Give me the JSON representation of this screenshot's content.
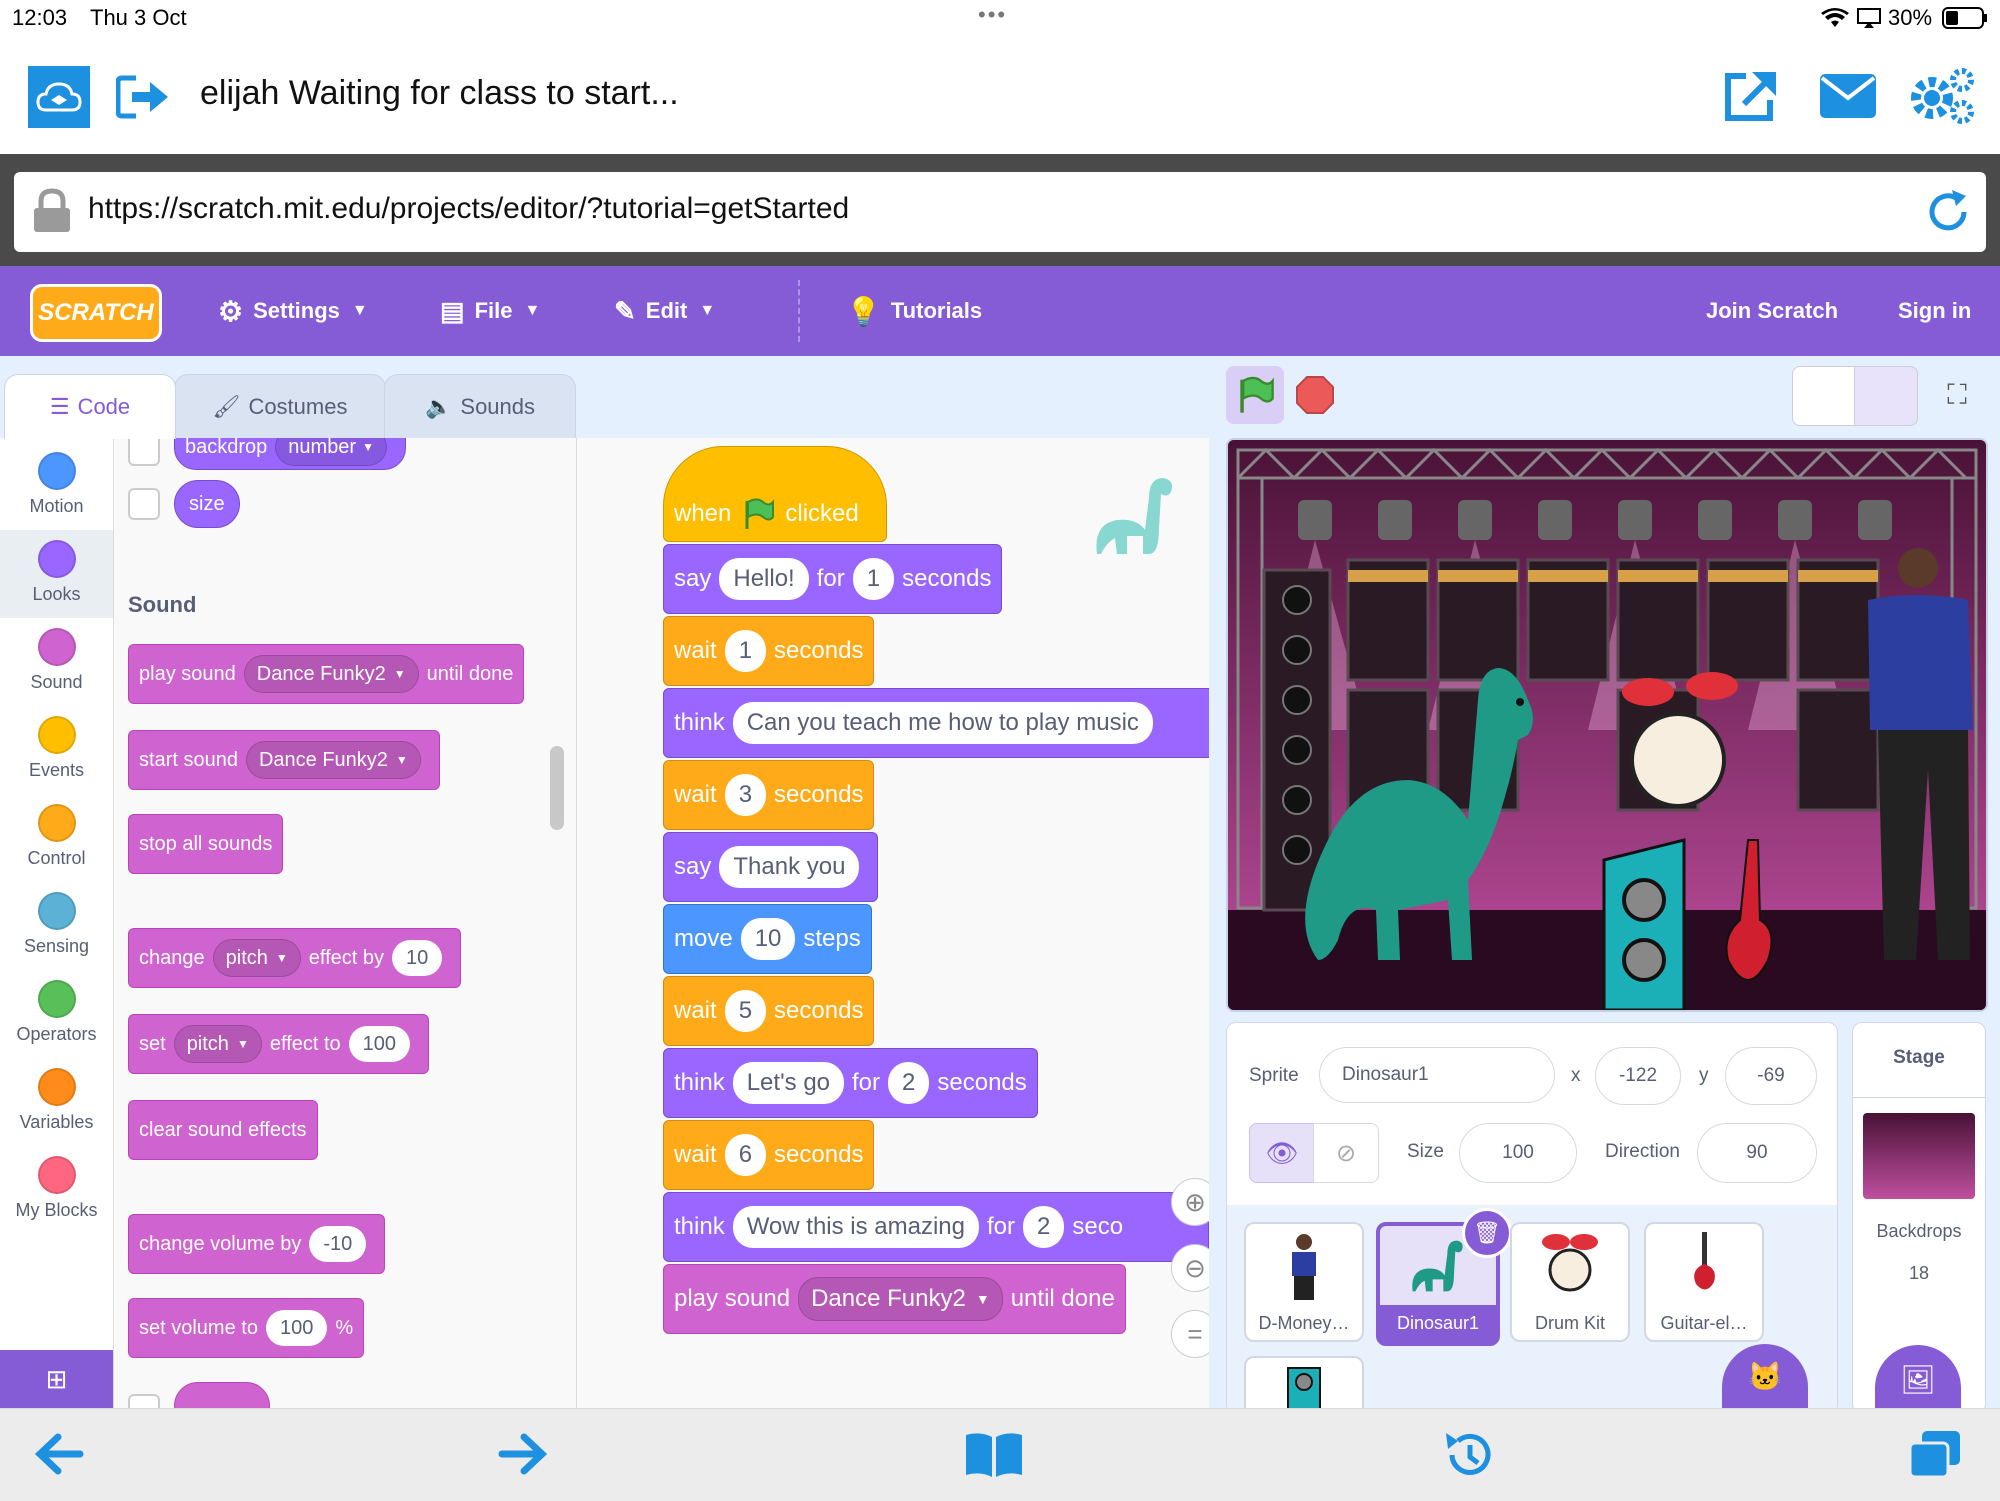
{
  "status": {
    "time": "12:03",
    "date": "Thu 3 Oct",
    "battery": "30%"
  },
  "header": {
    "title": "elijah Waiting for class to start..."
  },
  "url": "https://scratch.mit.edu/projects/editor/?tutorial=getStarted",
  "menu": {
    "settings": "Settings",
    "file": "File",
    "edit": "Edit",
    "tutorials": "Tutorials",
    "join": "Join Scratch",
    "signin": "Sign in"
  },
  "logo_text": "SCRATCH",
  "tabs": {
    "code": "Code",
    "costumes": "Costumes",
    "sounds": "Sounds"
  },
  "categories": [
    {
      "label": "Motion",
      "color": "#4c97ff"
    },
    {
      "label": "Looks",
      "color": "#9966ff"
    },
    {
      "label": "Sound",
      "color": "#cf63cf"
    },
    {
      "label": "Events",
      "color": "#ffbf00"
    },
    {
      "label": "Control",
      "color": "#ffab19"
    },
    {
      "label": "Sensing",
      "color": "#5cb1d6"
    },
    {
      "label": "Operators",
      "color": "#59c059"
    },
    {
      "label": "Variables",
      "color": "#ff8c1a"
    },
    {
      "label": "My Blocks",
      "color": "#ff6680"
    }
  ],
  "palette": {
    "backdrop": "backdrop",
    "number": "number",
    "size": "size",
    "sound_heading": "Sound",
    "play_sound": "play sound",
    "until_done": "until done",
    "sound_name": "Dance Funky2",
    "start_sound": "start sound",
    "stop_all": "stop all sounds",
    "change": "change",
    "pitch": "pitch",
    "effect_by": "effect by",
    "change_val": "10",
    "set": "set",
    "effect_to": "effect to",
    "set_val": "100",
    "clear": "clear sound effects",
    "change_volume": "change volume by",
    "vol_change": "-10",
    "set_volume": "set volume to",
    "vol_set": "100",
    "percent": "%"
  },
  "script": {
    "when": "when",
    "clicked": "clicked",
    "say": "say",
    "think": "think",
    "wait": "wait",
    "for": "for",
    "seconds": "seconds",
    "move": "move",
    "steps": "steps",
    "hello": "Hello!",
    "v1": "1",
    "w1": "1",
    "think1": "Can you teach me how to play music",
    "w3": "3",
    "thanks": "Thank you",
    "steps10": "10",
    "w5": "5",
    "letsgo": "Let's go",
    "t2": "2",
    "w6": "6",
    "amazing": "Wow this is amazing",
    "t2b": "2",
    "secs_cut": "seco",
    "play_sound": "play sound",
    "sound_name": "Dance Funky2",
    "until_done": "until done"
  },
  "sprite": {
    "label": "Sprite",
    "name": "Dinosaur1",
    "x_label": "x",
    "x": "-122",
    "y_label": "y",
    "y": "-69",
    "size_label": "Size",
    "size": "100",
    "direction_label": "Direction",
    "direction": "90"
  },
  "sprites": [
    "D-Money…",
    "Dinosaur1",
    "Drum Kit",
    "Guitar-el…"
  ],
  "stage": {
    "label": "Stage",
    "backdrops_label": "Backdrops",
    "backdrops": "18"
  }
}
